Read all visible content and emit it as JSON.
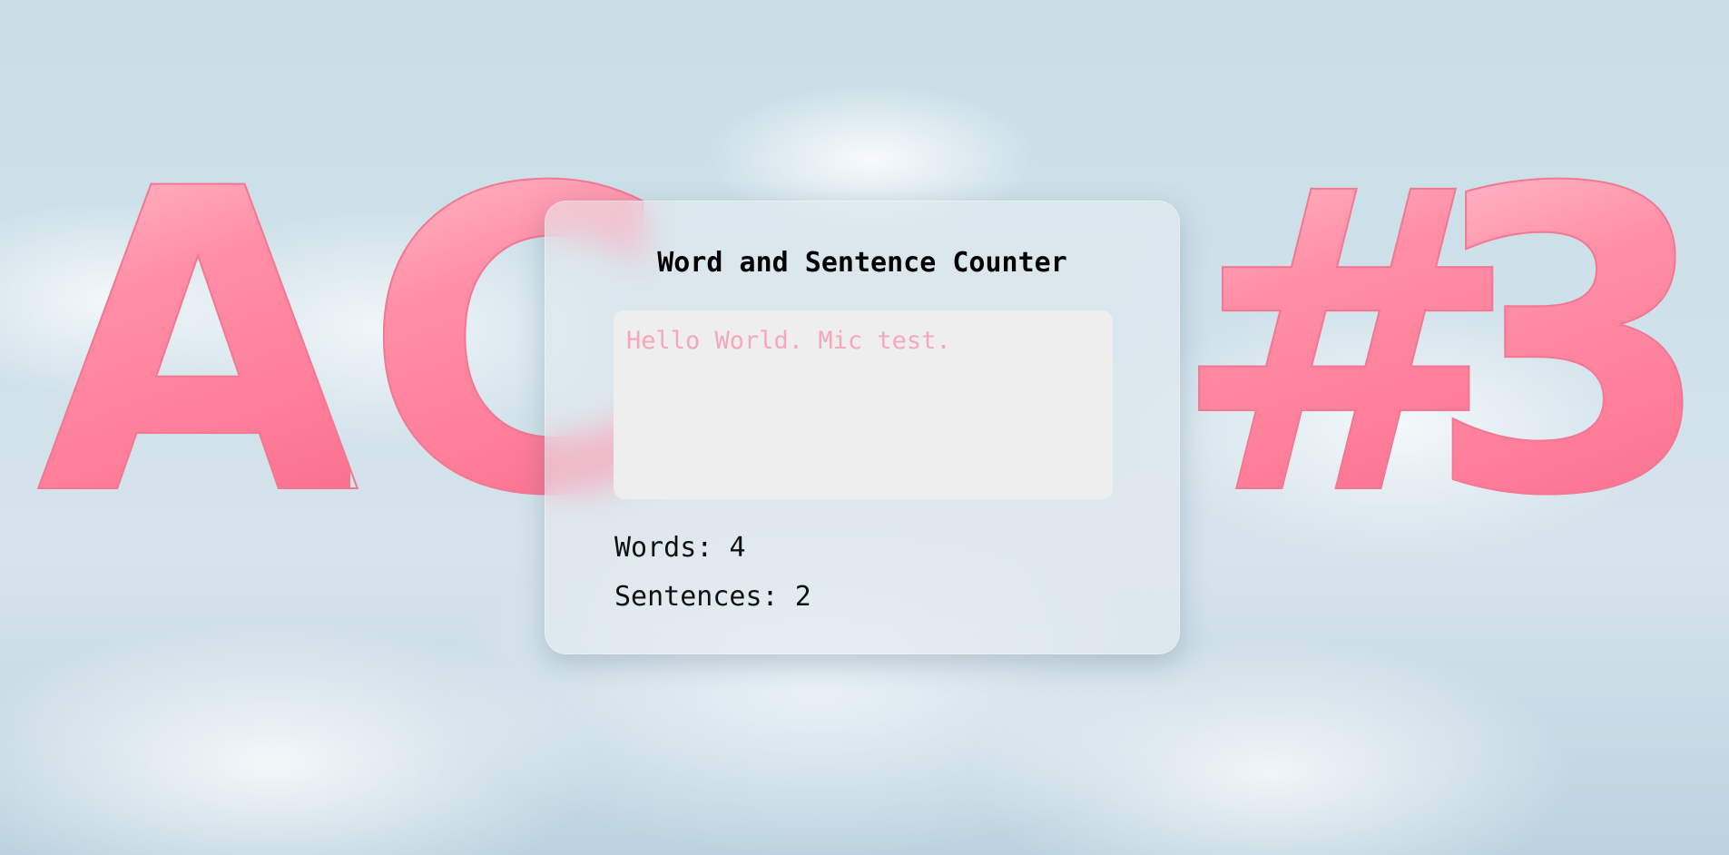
{
  "background": {
    "letters": [
      "A",
      "C",
      "#",
      "3"
    ]
  },
  "counter": {
    "title": "Word and Sentence Counter",
    "input_value": "",
    "input_placeholder": "Hello World. Mic test.",
    "words_label": "Words:",
    "words_count": "4",
    "sentences_label": "Sentences:",
    "sentences_count": "2"
  },
  "colors": {
    "accent_pink": "#ff8aa2",
    "placeholder_pink": "#f6a6bd",
    "sky": "#c9dee7"
  }
}
